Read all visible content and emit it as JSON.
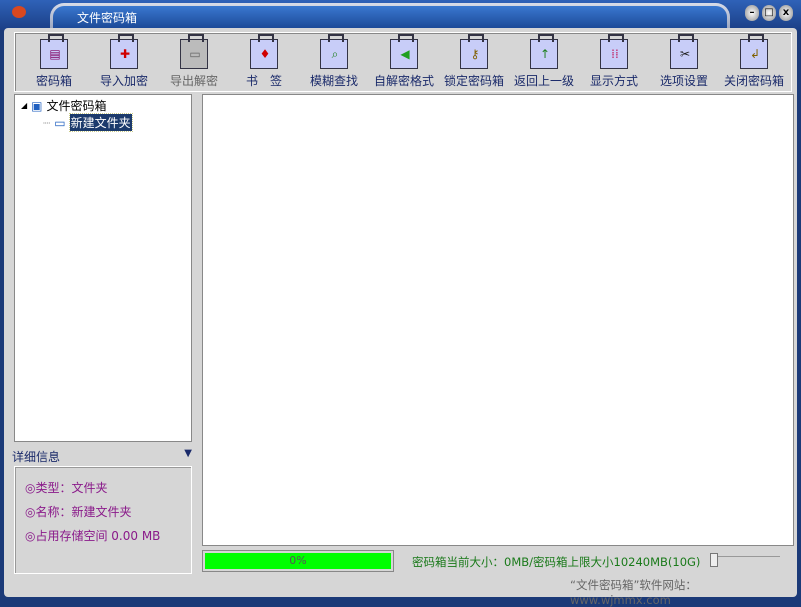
{
  "window": {
    "title": "文件密码箱",
    "controls": [
      "minimize",
      "maximize",
      "close"
    ]
  },
  "toolbar": [
    {
      "label": "密码箱",
      "icon": "safe-icon",
      "enabled": true,
      "glyph": "▤",
      "color": "#800060"
    },
    {
      "label": "导入加密",
      "icon": "import-encrypt-icon",
      "enabled": true,
      "glyph": "✚",
      "color": "#d00000"
    },
    {
      "label": "导出解密",
      "icon": "export-decrypt-icon",
      "enabled": false,
      "glyph": "▭",
      "color": "#666666"
    },
    {
      "label": "书　签",
      "icon": "bookmark-icon",
      "enabled": true,
      "glyph": "♦",
      "color": "#d00000"
    },
    {
      "label": "模糊查找",
      "icon": "search-icon",
      "enabled": true,
      "glyph": "⌕",
      "color": "#208020"
    },
    {
      "label": "自解密格式",
      "icon": "self-decrypt-icon",
      "enabled": true,
      "glyph": "◀",
      "color": "#20a020"
    },
    {
      "label": "锁定密码箱",
      "icon": "key-icon",
      "enabled": true,
      "glyph": "⚷",
      "color": "#806000"
    },
    {
      "label": "返回上一级",
      "icon": "up-arrow-icon",
      "enabled": true,
      "glyph": "↑",
      "color": "#208020"
    },
    {
      "label": "显示方式",
      "icon": "view-grid-icon",
      "enabled": true,
      "glyph": "⁞⁞",
      "color": "#c02060"
    },
    {
      "label": "选项设置",
      "icon": "settings-icon",
      "enabled": true,
      "glyph": "✂",
      "color": "#202020"
    },
    {
      "label": "关闭密码箱",
      "icon": "close-safe-icon",
      "enabled": true,
      "glyph": "↲",
      "color": "#806000"
    }
  ],
  "tree": {
    "root": "文件密码箱",
    "child": "新建文件夹"
  },
  "details": {
    "header": "详细信息",
    "type": "◎类型：文件夹",
    "name": "◎名称：新建文件夹",
    "size": "◎占用存储空间 0.00 MB"
  },
  "progress": {
    "value": 0,
    "label": "0%"
  },
  "status": "密码箱当前大小：0MB/密码箱上限大小10240MB(10G)",
  "footer": "“文件密码箱”软件网站：www.wjmmx.com"
}
